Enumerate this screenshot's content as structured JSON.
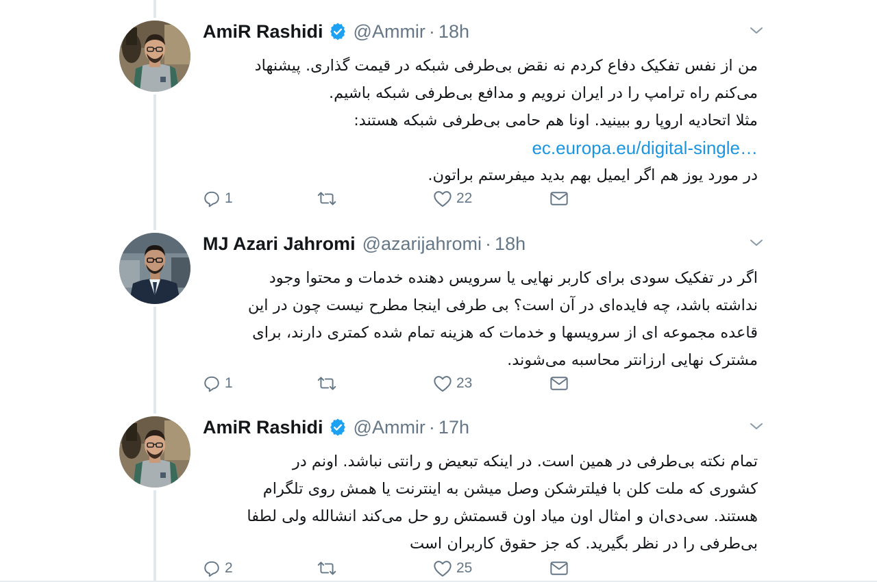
{
  "colors": {
    "link": "#1b95e0",
    "muted": "#657786",
    "verified": "#1da1f2",
    "thread_line": "#e1e8ed"
  },
  "tweets": [
    {
      "name": "AmiR Rashidi",
      "verified": true,
      "handle": "@Ammir",
      "separator": "·",
      "time": "18h",
      "avatar": "avatar-photo-man-glasses",
      "text_lines": [
        "من از نفس تفکیک دفاع کردم نه نقض بی‌طرفی شبکه در قیمت گذاری. پیشنهاد",
        "می‌کنم راه ترامپ را در ایران نرویم و مدافع بی‌طرفی شبکه باشیم.",
        "مثلا اتحادیه اروپا رو ببینید. اونا هم حامی بی‌طرفی شبکه هستند:"
      ],
      "link": "ec.europa.eu/digital-single…",
      "text_after": "در مورد یوز هم اگر ایمیل بهم بدید میفرستم براتون.",
      "replies": "1",
      "retweets": "",
      "likes": "22"
    },
    {
      "name": "MJ Azari Jahromi",
      "verified": false,
      "handle": "@azarijahromi",
      "separator": "·",
      "time": "18h",
      "avatar": "avatar-photo-man-suit",
      "text_lines": [
        "اگر در تفکیک سودی برای کاربر نهایی یا سرویس دهنده خدمات و محتوا وجود",
        "نداشته باشد، چه فایده‌ای در آن است؟ بی طرفی اینجا مطرح نیست چون در این",
        "قاعده  مجموعه ای از سرویسها و خدمات که هزینه تمام شده کمتری دارند، برای",
        "مشترک نهایی ارزانتر محاسبه می‌شوند."
      ],
      "replies": "1",
      "retweets": "",
      "likes": "23"
    },
    {
      "name": "AmiR Rashidi",
      "verified": true,
      "handle": "@Ammir",
      "separator": "·",
      "time": "17h",
      "avatar": "avatar-photo-man-glasses",
      "text_lines": [
        "تمام نکته بی‌طرفی در همین است. در اینکه تبعیض و رانتی نباشد. اونم در",
        "کشوری که ملت کلن با فیلترشکن وصل میشن به اینترنت یا همش روی تلگرام",
        "هستند. سی‌دی‌ان و امثال اون میاد اون قسمتش رو حل می‌کند انشالله ولی لطفا",
        "بی‌طرفی را در نظر بگیرید. که جز حقوق کاربران است"
      ],
      "replies": "2",
      "retweets": "",
      "likes": "25"
    }
  ]
}
